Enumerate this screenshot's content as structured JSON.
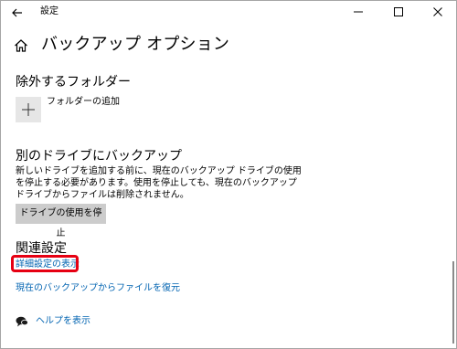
{
  "window": {
    "app_title": "設定",
    "controls": {
      "minimize": "—",
      "maximize": "☐",
      "close": "✕"
    }
  },
  "page": {
    "title": "バックアップ オプション",
    "icon": "home-icon"
  },
  "exclude_section": {
    "title": "除外するフォルダー",
    "add_folder_label": "フォルダーの追加",
    "add_icon": "plus-icon"
  },
  "other_drive_section": {
    "title": "別のドライブにバックアップ",
    "description": "新しいドライブを追加する前に、現在のバックアップ ドライブの使用を停止する必要があります。使用を停止しても、現在のバックアップ ドライブからファイルは削除されません。",
    "stop_button_label": "ドライブの使用を停止"
  },
  "related_section": {
    "title": "関連設定",
    "advanced_link": "詳細設定の表示",
    "restore_link": "現在のバックアップからファイルを復元",
    "highlight_color": "#e60012"
  },
  "help": {
    "label": "ヘルプを表示",
    "icon": "help-chat-icon"
  },
  "colors": {
    "link": "#0063b1",
    "button_bg": "#cccccc",
    "tile_bg": "#e6e6e6"
  }
}
